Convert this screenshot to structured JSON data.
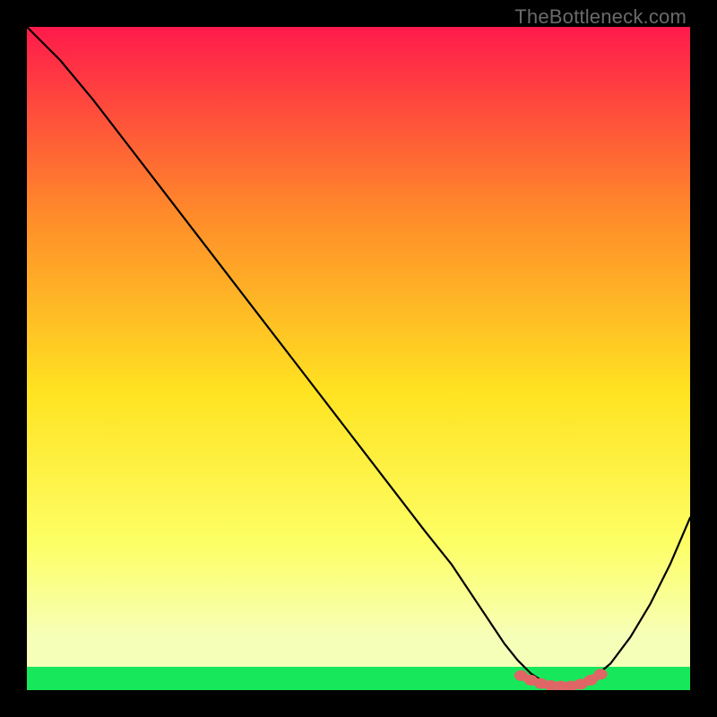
{
  "watermark": "TheBottleneck.com",
  "chart_data": {
    "type": "line",
    "title": "",
    "xlabel": "",
    "ylabel": "",
    "xlim": [
      0,
      100
    ],
    "ylim": [
      0,
      100
    ],
    "gradient_colors": {
      "top": "#ff1a4b",
      "upper_mid": "#ff8a2a",
      "mid": "#ffe321",
      "lower_mid": "#fdff66",
      "near_bottom": "#f6ffb8",
      "bottom_band": "#17e85b"
    },
    "curve_color": "#000000",
    "marker_color": "#e06666",
    "series": [
      {
        "name": "bottleneck-curve",
        "x": [
          0,
          5,
          10,
          15,
          20,
          25,
          30,
          35,
          40,
          45,
          50,
          55,
          60,
          62,
          64,
          66,
          68,
          70,
          72,
          74,
          76,
          78,
          80,
          82,
          85,
          88,
          91,
          94,
          97,
          100
        ],
        "y": [
          100,
          95,
          89,
          82.5,
          76,
          69.5,
          63,
          56.5,
          50,
          43.5,
          37,
          30.5,
          24,
          21.5,
          19,
          16,
          13,
          10,
          7,
          4.5,
          2.5,
          1.2,
          0.6,
          0.6,
          1.5,
          4,
          8,
          13,
          19,
          26
        ]
      }
    ],
    "markers": {
      "name": "optimal-zone",
      "x": [
        74.5,
        76,
        77.5,
        79,
        80.5,
        82,
        83.5,
        85,
        86.5
      ],
      "y": [
        2.2,
        1.5,
        1.0,
        0.7,
        0.6,
        0.6,
        0.9,
        1.5,
        2.4
      ]
    }
  }
}
